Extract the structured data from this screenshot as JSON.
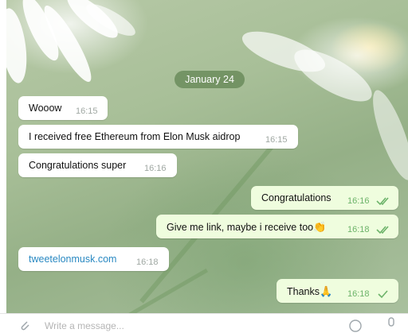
{
  "date_separator": "January 24",
  "messages": [
    {
      "text": "Wooow",
      "time": "16:15",
      "direction": "in"
    },
    {
      "text": "I received free Ethereum from Elon Musk aidrop",
      "time": "16:15",
      "direction": "in"
    },
    {
      "text": "Congratulations super",
      "time": "16:16",
      "direction": "in"
    },
    {
      "text": "Congratulations",
      "time": "16:16",
      "direction": "out",
      "status": "read"
    },
    {
      "text": "Give me link, maybe i receive too",
      "emoji": "👏",
      "time": "16:18",
      "direction": "out",
      "status": "read"
    },
    {
      "text": "tweetelonmusk.com",
      "time": "16:18",
      "direction": "in",
      "is_link": true
    },
    {
      "text": "Thanks",
      "emoji": "🙏",
      "time": "16:18",
      "direction": "out",
      "status": "sent"
    }
  ],
  "composer": {
    "placeholder": "Write a message..."
  },
  "icons": [
    "paperclip-icon",
    "emoji-icon",
    "microphone-icon",
    "double-check-icon",
    "check-icon"
  ],
  "colors": {
    "outgoing_bubble": "#effdde",
    "incoming_bubble": "#ffffff",
    "check": "#6db36a",
    "link": "#2a89c2",
    "date_pill": "#6a8a58"
  }
}
